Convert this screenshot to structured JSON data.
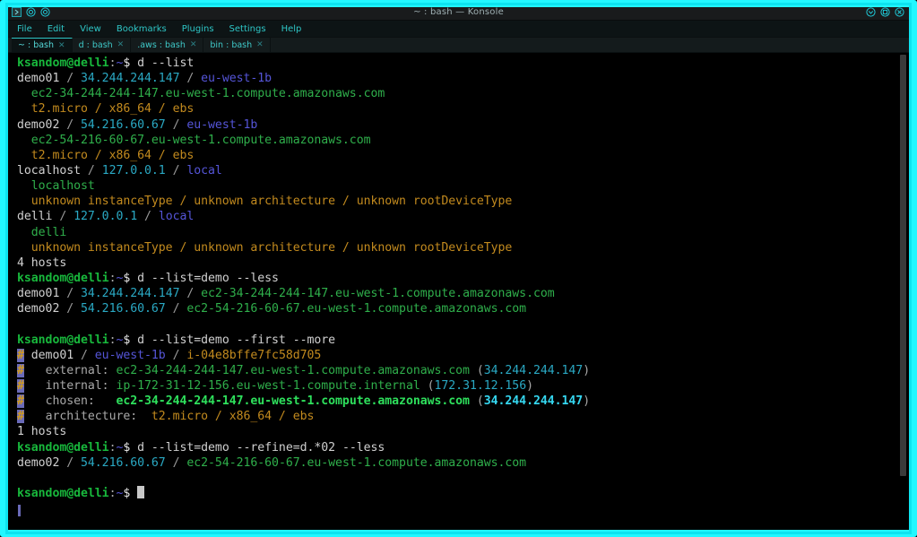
{
  "window": {
    "title": "~ : bash — Konsole",
    "left_buttons": [
      {
        "name": "window-menu-icon",
        "glyph": "›"
      },
      {
        "name": "sticky-icon",
        "glyph": "◎"
      },
      {
        "name": "shade-icon",
        "glyph": "◎"
      }
    ],
    "right_buttons": [
      {
        "name": "minimize-button",
        "glyph": "⌄"
      },
      {
        "name": "maximize-button",
        "glyph": "□"
      },
      {
        "name": "close-button",
        "glyph": "✕"
      }
    ]
  },
  "menubar": {
    "items": [
      "File",
      "Edit",
      "View",
      "Bookmarks",
      "Plugins",
      "Settings",
      "Help"
    ]
  },
  "tabbar": {
    "close_glyph": "✕",
    "tabs": [
      {
        "label": "~ : bash",
        "active": true
      },
      {
        "label": "d : bash",
        "active": false
      },
      {
        "label": ".aws : bash",
        "active": false
      },
      {
        "label": "bin : bash",
        "active": false
      }
    ]
  },
  "terminal": {
    "prompt": {
      "user_host": "ksandom@delli",
      "colon": ":",
      "path": "~",
      "sign": "$"
    },
    "colors": {
      "background": "#000000",
      "foreground": "#d0d0d0",
      "green": "#2faf4b",
      "bright_green": "#2ee05c",
      "cyan": "#2aa9c4",
      "bright_cyan": "#35d7f0",
      "blue": "#5555d8",
      "orange": "#c28a1e",
      "bar_background": "#6a6ab8",
      "accent_cyan_border": "#22f7ff"
    },
    "commands": {
      "cmd1": "d --list",
      "cmd2": "d --list=demo --less",
      "cmd3": "d --list=demo --first --more",
      "cmd4": "d --list=demo --refine=d.*02 --less"
    },
    "lines": [
      {
        "type": "prompt",
        "command": "d --list"
      },
      {
        "type": "host_header",
        "name": "demo01",
        "ip": "34.244.244.147",
        "zone": "eu-west-1b"
      },
      {
        "type": "host_dns",
        "indent": 2,
        "dns": "ec2-34-244-244-147.eu-west-1.compute.amazonaws.com"
      },
      {
        "type": "host_spec",
        "indent": 2,
        "spec": "t2.micro / x86_64 / ebs"
      },
      {
        "type": "host_header",
        "name": "demo02",
        "ip": "54.216.60.67",
        "zone": "eu-west-1b"
      },
      {
        "type": "host_dns",
        "indent": 2,
        "dns": "ec2-54-216-60-67.eu-west-1.compute.amazonaws.com"
      },
      {
        "type": "host_spec",
        "indent": 2,
        "spec": "t2.micro / x86_64 / ebs"
      },
      {
        "type": "host_header",
        "name": "localhost",
        "ip": "127.0.0.1",
        "zone": "local"
      },
      {
        "type": "host_dns",
        "indent": 2,
        "dns": "localhost"
      },
      {
        "type": "host_spec",
        "indent": 2,
        "spec": "unknown instanceType / unknown architecture / unknown rootDeviceType"
      },
      {
        "type": "host_header",
        "name": "delli",
        "ip": "127.0.0.1",
        "zone": "local"
      },
      {
        "type": "host_dns",
        "indent": 2,
        "dns": "delli"
      },
      {
        "type": "host_spec",
        "indent": 2,
        "spec": "unknown instanceType / unknown architecture / unknown rootDeviceType"
      },
      {
        "type": "count",
        "text": "4 hosts"
      },
      {
        "type": "prompt",
        "command": "d --list=demo --less"
      },
      {
        "type": "less_row",
        "name": "demo01",
        "ip": "34.244.244.147",
        "dns": "ec2-34-244-244-147.eu-west-1.compute.amazonaws.com"
      },
      {
        "type": "less_row",
        "name": "demo02",
        "ip": "54.216.60.67",
        "dns": "ec2-54-216-60-67.eu-west-1.compute.amazonaws.com"
      },
      {
        "type": "blank"
      },
      {
        "type": "prompt",
        "command": "d --list=demo --first --more"
      },
      {
        "type": "more_header",
        "bar": "#",
        "name": "demo01",
        "zone": "eu-west-1b",
        "instance_id": "i-04e8bffe7fc58d705"
      },
      {
        "type": "more_field",
        "bar": "#",
        "label": "external:",
        "dns": "ec2-34-244-244-147.eu-west-1.compute.amazonaws.com",
        "ip": "34.244.244.147"
      },
      {
        "type": "more_field",
        "bar": "#",
        "label": "internal:",
        "dns": "ip-172-31-12-156.eu-west-1.compute.internal",
        "ip": "172.31.12.156"
      },
      {
        "type": "more_chosen",
        "bar": "#",
        "label": "chosen:",
        "dns": "ec2-34-244-244-147.eu-west-1.compute.amazonaws.com",
        "ip": "34.244.244.147"
      },
      {
        "type": "more_arch",
        "bar": "#",
        "label": "architecture:",
        "spec": "t2.micro / x86_64 / ebs"
      },
      {
        "type": "count",
        "text": "1 hosts"
      },
      {
        "type": "prompt",
        "command": "d --list=demo --refine=d.*02 --less"
      },
      {
        "type": "less_row",
        "name": "demo02",
        "ip": "54.216.60.67",
        "dns": "ec2-54-216-60-67.eu-west-1.compute.amazonaws.com"
      },
      {
        "type": "blank"
      },
      {
        "type": "prompt_cursor",
        "command": ""
      }
    ]
  }
}
